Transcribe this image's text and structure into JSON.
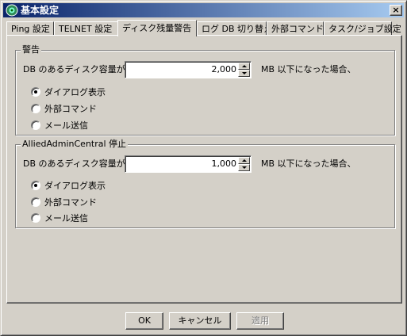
{
  "window": {
    "title": "基本設定",
    "close_label": "×"
  },
  "tabs": [
    {
      "label": "Ping 設定"
    },
    {
      "label": "TELNET 設定"
    },
    {
      "label": "ディスク残量警告"
    },
    {
      "label": "ログ DB 切り替え"
    },
    {
      "label": "外部コマンド"
    },
    {
      "label": "タスク/ジョブ設定"
    }
  ],
  "active_tab": "ディスク残量警告",
  "warning_group": {
    "title": "警告",
    "prefix_label": "DB のあるディスク容量が",
    "value": "2,000",
    "suffix_label": "MB 以下になった場合、",
    "options": [
      {
        "label": "ダイアログ表示",
        "selected": true
      },
      {
        "label": "外部コマンド",
        "selected": false
      },
      {
        "label": "メール送信",
        "selected": false
      }
    ]
  },
  "stop_group": {
    "title": "AlliedAdminCentral 停止",
    "prefix_label": "DB のあるディスク容量が",
    "value": "1,000",
    "suffix_label": "MB 以下になった場合、",
    "options": [
      {
        "label": "ダイアログ表示",
        "selected": true
      },
      {
        "label": "外部コマンド",
        "selected": false
      },
      {
        "label": "メール送信",
        "selected": false
      }
    ]
  },
  "buttons": {
    "ok": "OK",
    "cancel": "キャンセル",
    "apply": "適用"
  }
}
